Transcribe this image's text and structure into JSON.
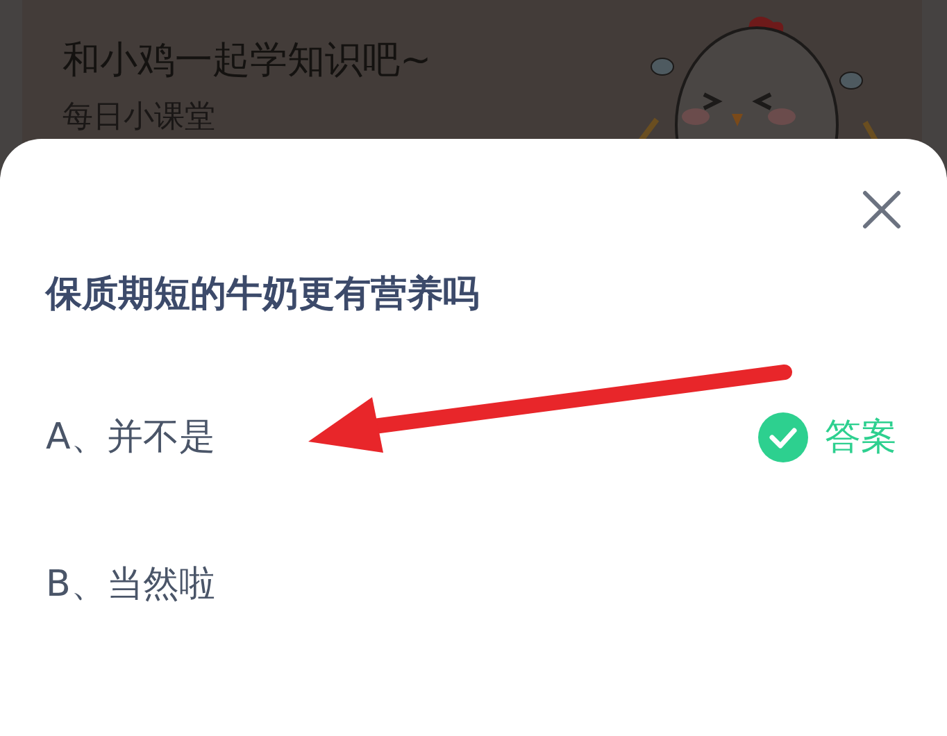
{
  "header": {
    "title": "和小鸡一起学知识吧~",
    "subtitle": "每日小课堂"
  },
  "quiz": {
    "question": "保质期短的牛奶更有营养吗",
    "answer_label": "答案",
    "options": [
      {
        "label": "A、并不是",
        "is_answer": true
      },
      {
        "label": "B、当然啦",
        "is_answer": false
      }
    ]
  }
}
